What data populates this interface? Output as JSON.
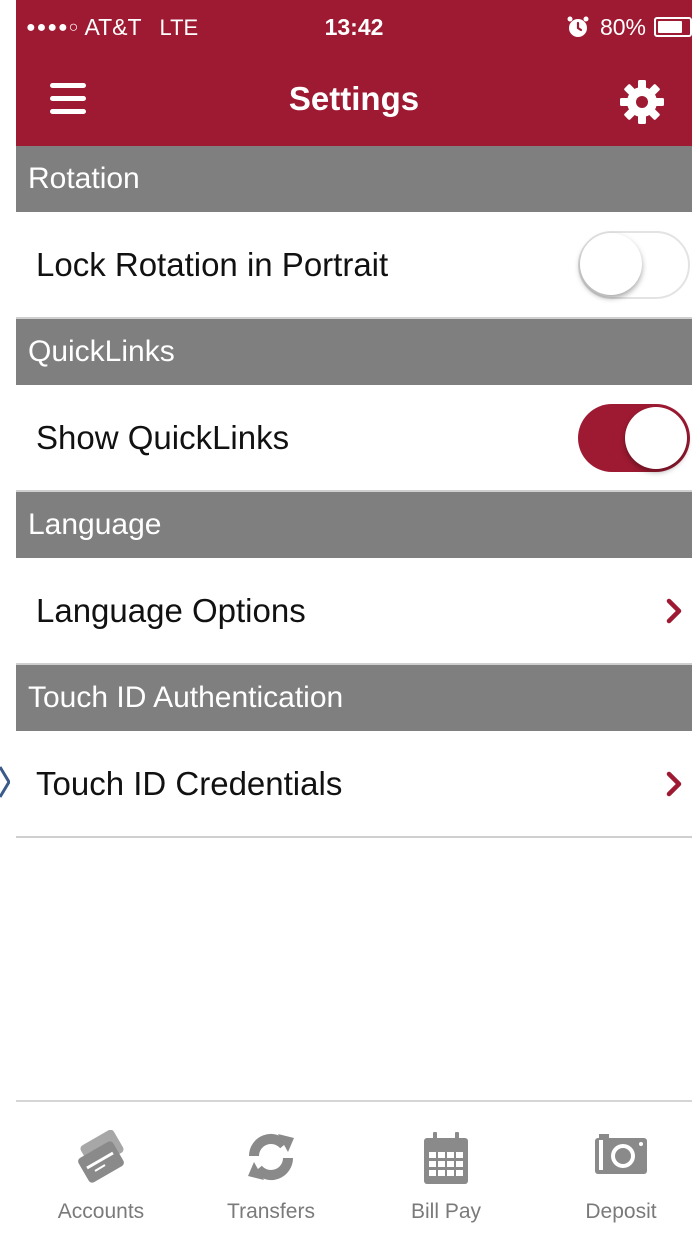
{
  "status_bar": {
    "signal": "●●●●○",
    "carrier": "AT&T",
    "network": "LTE",
    "time": "13:42",
    "battery": "80%",
    "battery_level": 0.8
  },
  "nav": {
    "title": "Settings"
  },
  "sections": [
    {
      "header": "Rotation",
      "row_label": "Lock Rotation in Portrait",
      "control": "toggle",
      "toggle_on": false
    },
    {
      "header": "QuickLinks",
      "row_label": "Show QuickLinks",
      "control": "toggle",
      "toggle_on": true
    },
    {
      "header": "Language",
      "row_label": "Language Options",
      "control": "chevron"
    },
    {
      "header": "Touch ID Authentication",
      "row_label": "Touch ID Credentials",
      "control": "chevron"
    }
  ],
  "tabs": [
    {
      "label": "Accounts",
      "icon": "credit-card-icon"
    },
    {
      "label": "Transfers",
      "icon": "refresh-arrows-icon"
    },
    {
      "label": "Bill Pay",
      "icon": "calendar-icon"
    },
    {
      "label": "Deposit",
      "icon": "camera-icon"
    }
  ],
  "colors": {
    "brand": "#9e1a32",
    "section_header": "#7f7f7f",
    "tab_icon": "#8a8a8a"
  }
}
